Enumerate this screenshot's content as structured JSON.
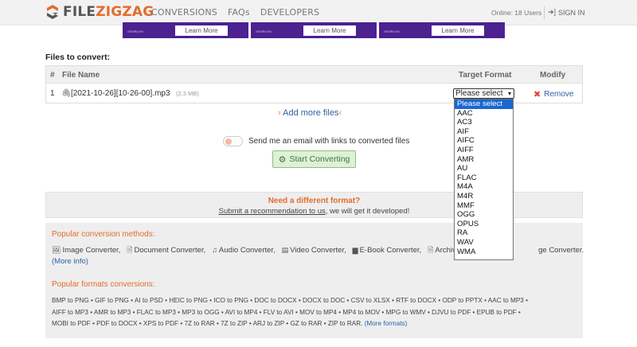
{
  "header": {
    "logo_prefix": "FILE",
    "logo_highlight": "ZIGZAG",
    "nav": [
      "CONVERSIONS",
      "FAQs",
      "DEVELOPERS"
    ],
    "online": "Online: 18 Users",
    "signin": "SIGN IN"
  },
  "ads": [
    {
      "button": "Learn More",
      "brand": "SEMRUSH"
    },
    {
      "button": "Learn More",
      "brand": "SEMRUSH"
    },
    {
      "button": "Learn More",
      "brand": "SEMRUSH"
    }
  ],
  "files": {
    "section_label": "Files to convert:",
    "columns": {
      "num": "#",
      "name": "File Name",
      "target": "Target Format",
      "modify": "Modify"
    },
    "row": {
      "num": "1",
      "name": "[2021-10-26][10-26-00].mp3",
      "size": "(2.3 MB)",
      "select_value": "Please select",
      "remove": "Remove"
    },
    "add_more": "Add more files"
  },
  "email": {
    "label": "Send me an email with links to converted files",
    "enabled": false
  },
  "start_button": "Start Converting",
  "different": {
    "title": "Need a different format?",
    "link": "Submit a recommendation to us",
    "suffix": ", we will get it developed!"
  },
  "methods": {
    "title": "Popular conversion methods:",
    "items": [
      "Image Converter,",
      "Document Converter,",
      "Audio Converter,",
      "Video Converter,",
      "E-Book Converter,",
      "Archive Con",
      "ge Converter."
    ],
    "more_info": "(More info)"
  },
  "formats": {
    "title": "Popular formats conversions:",
    "line1": "BMP to PNG • GIF to PNG • AI to PSD • HEIC to PNG • ICO to PNG • DOC to DOCX • DOCX to DOC • CSV to XLSX • RTF to DOCX • ODP to PPTX • AAC to MP3 •",
    "line2": "AIFF to MP3 • AMR to MP3 • FLAC to MP3 • MP3 to OGG • AVI to MP4 • FLV to AVI • MOV to MP4 • MP4 to MOV • MPG to WMV • DJVU to PDF • EPUB to PDF •",
    "line3": "MOBI to PDF • PDF to DOCX • XPS to PDF • 7Z to RAR • 7Z to ZIP • ARJ to ZIP • GZ to RAR • ZIP to RAR.",
    "more": "(More formats)"
  },
  "dropdown": {
    "selected": "Please select",
    "options": [
      "Please select",
      "AAC",
      "AC3",
      "AIF",
      "AIFC",
      "AIFF",
      "AMR",
      "AU",
      "FLAC",
      "M4A",
      "M4R",
      "MMF",
      "OGG",
      "OPUS",
      "RA",
      "WAV",
      "WMA"
    ]
  },
  "colors": {
    "brand_orange": "#e36c2c",
    "link_blue": "#2f5fa6",
    "ad_purple": "#4b2290",
    "select_highlight": "#1967d2"
  }
}
